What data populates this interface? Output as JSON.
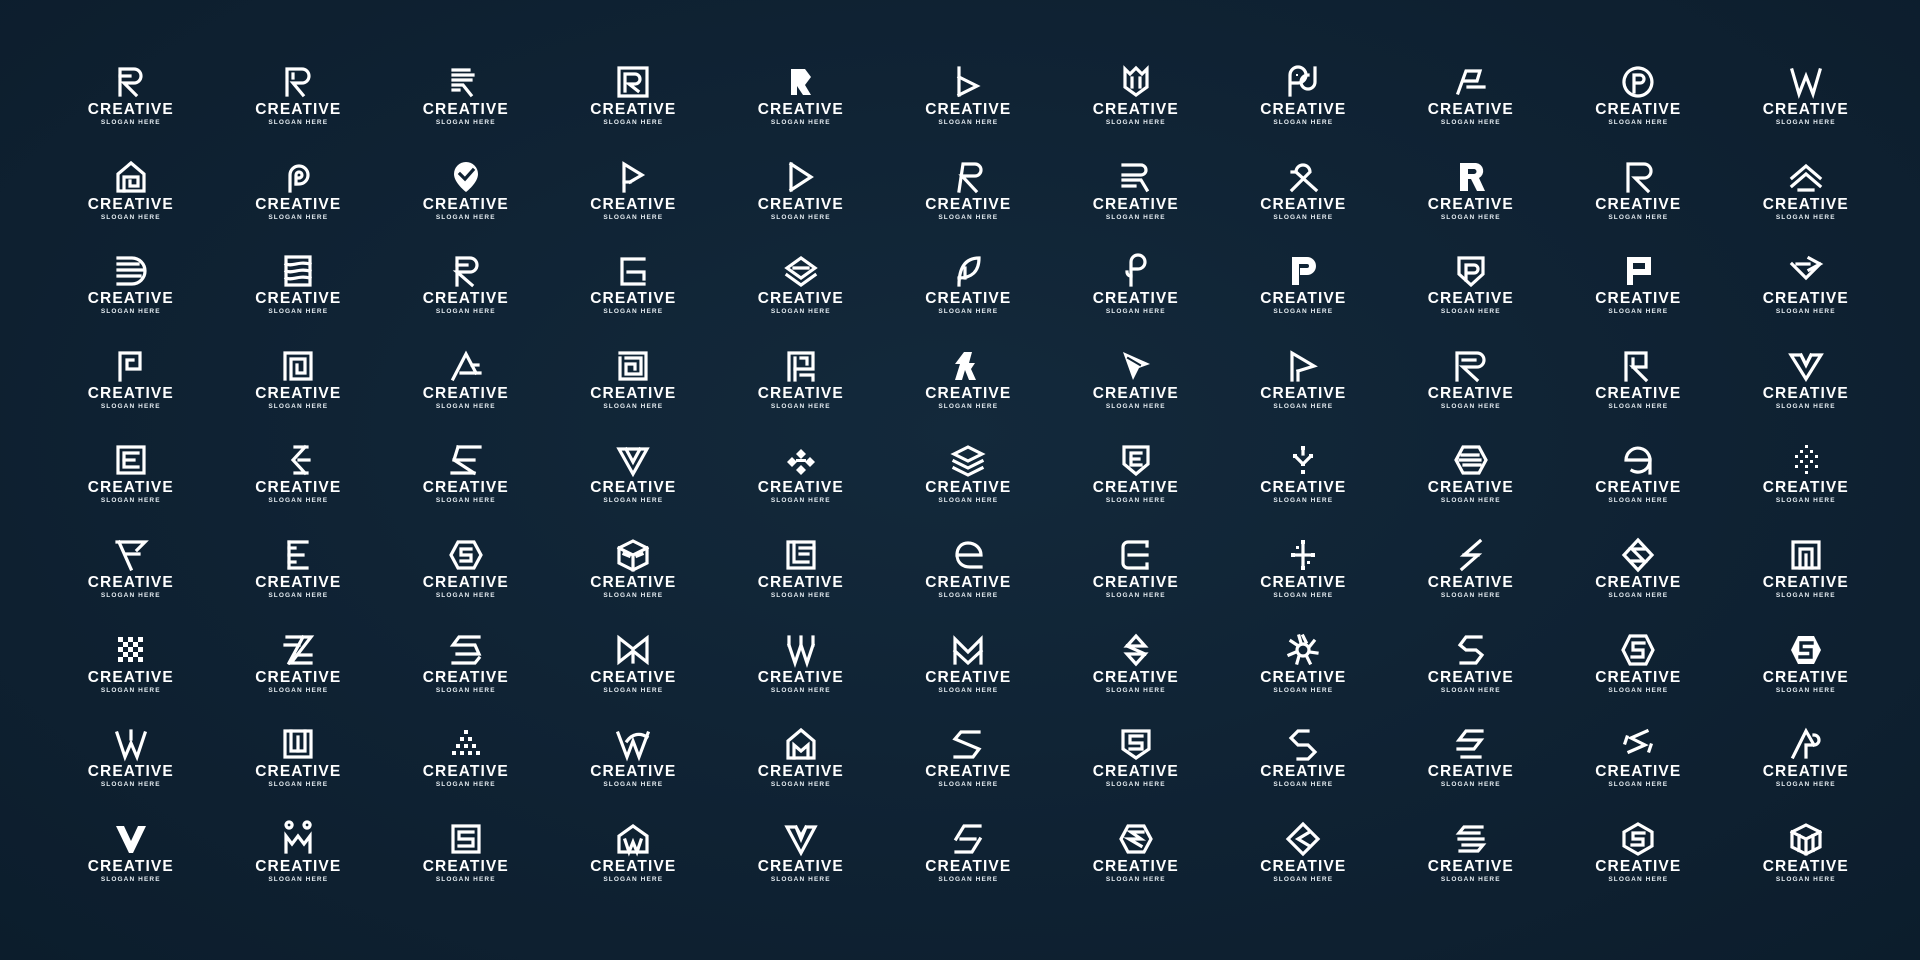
{
  "page": {
    "background_color": "#0f2233",
    "logo_color": "#ffffff"
  },
  "logos": [
    {
      "icon": "letter-r-stencil-icon",
      "brand": "CREATIVE",
      "slogan": "SLOGAN HERE"
    },
    {
      "icon": "letter-r-outline-icon",
      "brand": "CREATIVE",
      "slogan": "SLOGAN HERE"
    },
    {
      "icon": "letter-r-striped-icon",
      "brand": "CREATIVE",
      "slogan": "SLOGAN HERE"
    },
    {
      "icon": "letter-r-square-box-icon",
      "brand": "CREATIVE",
      "slogan": "SLOGAN HERE"
    },
    {
      "icon": "letter-r-geometric-icon",
      "brand": "CREATIVE",
      "slogan": "SLOGAN HERE"
    },
    {
      "icon": "letter-b-play-icon",
      "brand": "CREATIVE",
      "slogan": "SLOGAN HERE"
    },
    {
      "icon": "crown-shield-icon",
      "brand": "CREATIVE",
      "slogan": "SLOGAN HERE"
    },
    {
      "icon": "letter-pa-chat-icon",
      "brand": "CREATIVE",
      "slogan": "SLOGAN HERE"
    },
    {
      "icon": "letter-p-angled-icon",
      "brand": "CREATIVE",
      "slogan": "SLOGAN HERE"
    },
    {
      "icon": "letter-p-circle-icon",
      "brand": "CREATIVE",
      "slogan": "SLOGAN HERE"
    },
    {
      "icon": "letter-w-line-icon",
      "brand": "CREATIVE",
      "slogan": "SLOGAN HERE"
    },
    {
      "icon": "house-maze-icon",
      "brand": "CREATIVE",
      "slogan": "SLOGAN HERE"
    },
    {
      "icon": "letter-p-loop-icon",
      "brand": "CREATIVE",
      "slogan": "SLOGAN HERE"
    },
    {
      "icon": "pin-check-icon",
      "brand": "CREATIVE",
      "slogan": "SLOGAN HERE"
    },
    {
      "icon": "letter-p-triangle-icon",
      "brand": "CREATIVE",
      "slogan": "SLOGAN HERE"
    },
    {
      "icon": "letter-d-play-icon",
      "brand": "CREATIVE",
      "slogan": "SLOGAN HERE"
    },
    {
      "icon": "letter-r-slant-icon",
      "brand": "CREATIVE",
      "slogan": "SLOGAN HERE"
    },
    {
      "icon": "letter-r-lines-icon",
      "brand": "CREATIVE",
      "slogan": "SLOGAN HERE"
    },
    {
      "icon": "letter-r-knot-icon",
      "brand": "CREATIVE",
      "slogan": "SLOGAN HERE"
    },
    {
      "icon": "letter-r-bold-icon",
      "brand": "CREATIVE",
      "slogan": "SLOGAN HERE"
    },
    {
      "icon": "letter-r-modern-icon",
      "brand": "CREATIVE",
      "slogan": "SLOGAN HERE"
    },
    {
      "icon": "layered-chevron-icon",
      "brand": "CREATIVE",
      "slogan": "SLOGAN HERE"
    },
    {
      "icon": "letter-d-striped-icon",
      "brand": "CREATIVE",
      "slogan": "SLOGAN HERE"
    },
    {
      "icon": "letter-b-waves-icon",
      "brand": "CREATIVE",
      "slogan": "SLOGAN HERE"
    },
    {
      "icon": "letter-r-round-icon",
      "brand": "CREATIVE",
      "slogan": "SLOGAN HERE"
    },
    {
      "icon": "letter-e-rounded-icon",
      "brand": "CREATIVE",
      "slogan": "SLOGAN HERE"
    },
    {
      "icon": "layered-diamond-icon",
      "brand": "CREATIVE",
      "slogan": "SLOGAN HERE"
    },
    {
      "icon": "letter-p-leaf-icon",
      "brand": "CREATIVE",
      "slogan": "SLOGAN HERE"
    },
    {
      "icon": "letter-p-script-icon",
      "brand": "CREATIVE",
      "slogan": "SLOGAN HERE"
    },
    {
      "icon": "letter-p-dot-icon",
      "brand": "CREATIVE",
      "slogan": "SLOGAN HERE"
    },
    {
      "icon": "letter-p-shield-icon",
      "brand": "CREATIVE",
      "slogan": "SLOGAN HERE"
    },
    {
      "icon": "letter-p-pixel-icon",
      "brand": "CREATIVE",
      "slogan": "SLOGAN HERE"
    },
    {
      "icon": "layered-arrow-icon",
      "brand": "CREATIVE",
      "slogan": "SLOGAN HERE"
    },
    {
      "icon": "letter-p-outline-icon",
      "brand": "CREATIVE",
      "slogan": "SLOGAN HERE"
    },
    {
      "icon": "square-maze-icon",
      "brand": "CREATIVE",
      "slogan": "SLOGAN HERE"
    },
    {
      "icon": "letter-a-triangle-icon",
      "brand": "CREATIVE",
      "slogan": "SLOGAN HERE"
    },
    {
      "icon": "square-spiral-icon",
      "brand": "CREATIVE",
      "slogan": "SLOGAN HERE"
    },
    {
      "icon": "letter-p-block-icon",
      "brand": "CREATIVE",
      "slogan": "SLOGAN HERE"
    },
    {
      "icon": "letter-r-cut-icon",
      "brand": "CREATIVE",
      "slogan": "SLOGAN HERE"
    },
    {
      "icon": "cursor-arrow-icon",
      "brand": "CREATIVE",
      "slogan": "SLOGAN HERE"
    },
    {
      "icon": "letter-p-arrow-icon",
      "brand": "CREATIVE",
      "slogan": "SLOGAN HERE"
    },
    {
      "icon": "letter-r-wide-icon",
      "brand": "CREATIVE",
      "slogan": "SLOGAN HERE"
    },
    {
      "icon": "letter-r-frame-icon",
      "brand": "CREATIVE",
      "slogan": "SLOGAN HERE"
    },
    {
      "icon": "letter-w-diamond-icon",
      "brand": "CREATIVE",
      "slogan": "SLOGAN HERE"
    },
    {
      "icon": "letter-e-square-icon",
      "brand": "CREATIVE",
      "slogan": "SLOGAN HERE"
    },
    {
      "icon": "letter-e-chevron-icon",
      "brand": "CREATIVE",
      "slogan": "SLOGAN HERE"
    },
    {
      "icon": "letter-e-slant-icon",
      "brand": "CREATIVE",
      "slogan": "SLOGAN HERE"
    },
    {
      "icon": "letter-v-triangle-icon",
      "brand": "CREATIVE",
      "slogan": "SLOGAN HERE"
    },
    {
      "icon": "diamond-cluster-icon",
      "brand": "CREATIVE",
      "slogan": "SLOGAN HERE"
    },
    {
      "icon": "stacked-layers-icon",
      "brand": "CREATIVE",
      "slogan": "SLOGAN HERE"
    },
    {
      "icon": "letter-e-shield-icon",
      "brand": "CREATIVE",
      "slogan": "SLOGAN HERE"
    },
    {
      "icon": "connected-nodes-icon",
      "brand": "CREATIVE",
      "slogan": "SLOGAN HERE"
    },
    {
      "icon": "hexagon-stripes-icon",
      "brand": "CREATIVE",
      "slogan": "SLOGAN HERE"
    },
    {
      "icon": "letter-e-circle-icon",
      "brand": "CREATIVE",
      "slogan": "SLOGAN HERE"
    },
    {
      "icon": "pixel-diamond-icon",
      "brand": "CREATIVE",
      "slogan": "SLOGAN HERE"
    },
    {
      "icon": "letter-f-arrow-icon",
      "brand": "CREATIVE",
      "slogan": "SLOGAN HERE"
    },
    {
      "icon": "letter-e-dashed-icon",
      "brand": "CREATIVE",
      "slogan": "SLOGAN HERE"
    },
    {
      "icon": "letter-s-hexagon-icon",
      "brand": "CREATIVE",
      "slogan": "SLOGAN HERE"
    },
    {
      "icon": "cube-stripes-icon",
      "brand": "CREATIVE",
      "slogan": "SLOGAN HERE"
    },
    {
      "icon": "letter-e-maze-icon",
      "brand": "CREATIVE",
      "slogan": "SLOGAN HERE"
    },
    {
      "icon": "letter-e-leaf-icon",
      "brand": "CREATIVE",
      "slogan": "SLOGAN HERE"
    },
    {
      "icon": "letter-e-tech-icon",
      "brand": "CREATIVE",
      "slogan": "SLOGAN HERE"
    },
    {
      "icon": "dot-network-icon",
      "brand": "CREATIVE",
      "slogan": "SLOGAN HERE"
    },
    {
      "icon": "letter-s-zigzag-icon",
      "brand": "CREATIVE",
      "slogan": "SLOGAN HERE"
    },
    {
      "icon": "letter-s-diamond-icon",
      "brand": "CREATIVE",
      "slogan": "SLOGAN HERE"
    },
    {
      "icon": "square-frame-icon",
      "brand": "CREATIVE",
      "slogan": "SLOGAN HERE"
    },
    {
      "icon": "checker-pattern-icon",
      "brand": "CREATIVE",
      "slogan": "SLOGAN HERE"
    },
    {
      "icon": "letter-z-stripes-icon",
      "brand": "CREATIVE",
      "slogan": "SLOGAN HERE"
    },
    {
      "icon": "letter-s-layered-icon",
      "brand": "CREATIVE",
      "slogan": "SLOGAN HERE"
    },
    {
      "icon": "letter-m-bowtie-icon",
      "brand": "CREATIVE",
      "slogan": "SLOGAN HERE"
    },
    {
      "icon": "letter-w-pillars-icon",
      "brand": "CREATIVE",
      "slogan": "SLOGAN HERE"
    },
    {
      "icon": "letter-m-cross-icon",
      "brand": "CREATIVE",
      "slogan": "SLOGAN HERE"
    },
    {
      "icon": "letter-s-gem-icon",
      "brand": "CREATIVE",
      "slogan": "SLOGAN HERE"
    },
    {
      "icon": "spiral-sun-icon",
      "brand": "CREATIVE",
      "slogan": "SLOGAN HERE"
    },
    {
      "icon": "letter-s-angular-icon",
      "brand": "CREATIVE",
      "slogan": "SLOGAN HERE"
    },
    {
      "icon": "letter-s-hex-outline-icon",
      "brand": "CREATIVE",
      "slogan": "SLOGAN HERE"
    },
    {
      "icon": "letter-s-hex-solid-icon",
      "brand": "CREATIVE",
      "slogan": "SLOGAN HERE"
    },
    {
      "icon": "letter-w-crown-icon",
      "brand": "CREATIVE",
      "slogan": "SLOGAN HERE"
    },
    {
      "icon": "letter-w-square-icon",
      "brand": "CREATIVE",
      "slogan": "SLOGAN HERE"
    },
    {
      "icon": "dot-triangle-icon",
      "brand": "CREATIVE",
      "slogan": "SLOGAN HERE"
    },
    {
      "icon": "letter-w-swoosh-icon",
      "brand": "CREATIVE",
      "slogan": "SLOGAN HERE"
    },
    {
      "icon": "letter-w-house-icon",
      "brand": "CREATIVE",
      "slogan": "SLOGAN HERE"
    },
    {
      "icon": "letter-s-ribbon-icon",
      "brand": "CREATIVE",
      "slogan": "SLOGAN HERE"
    },
    {
      "icon": "letter-s-badge-icon",
      "brand": "CREATIVE",
      "slogan": "SLOGAN HERE"
    },
    {
      "icon": "letter-s-chain-icon",
      "brand": "CREATIVE",
      "slogan": "SLOGAN HERE"
    },
    {
      "icon": "letter-s-bolt-icon",
      "brand": "CREATIVE",
      "slogan": "SLOGAN HERE"
    },
    {
      "icon": "letter-s-wave-icon",
      "brand": "CREATIVE",
      "slogan": "SLOGAN HERE"
    },
    {
      "icon": "letter-a-p-icon",
      "brand": "CREATIVE",
      "slogan": "SLOGAN HERE"
    },
    {
      "icon": "letter-w-bold-icon",
      "brand": "CREATIVE",
      "slogan": "SLOGAN HERE"
    },
    {
      "icon": "letter-w-pins-icon",
      "brand": "CREATIVE",
      "slogan": "SLOGAN HERE"
    },
    {
      "icon": "letter-s-box-icon",
      "brand": "CREATIVE",
      "slogan": "SLOGAN HERE"
    },
    {
      "icon": "letter-w-house-outline-icon",
      "brand": "CREATIVE",
      "slogan": "SLOGAN HERE"
    },
    {
      "icon": "letter-w-heart-icon",
      "brand": "CREATIVE",
      "slogan": "SLOGAN HERE"
    },
    {
      "icon": "letter-s-cut-icon",
      "brand": "CREATIVE",
      "slogan": "SLOGAN HERE"
    },
    {
      "icon": "letter-s-hex-wide-icon",
      "brand": "CREATIVE",
      "slogan": "SLOGAN HERE"
    },
    {
      "icon": "letter-s-diamond-outline-icon",
      "brand": "CREATIVE",
      "slogan": "SLOGAN HERE"
    },
    {
      "icon": "letter-s-stacked-icon",
      "brand": "CREATIVE",
      "slogan": "SLOGAN HERE"
    },
    {
      "icon": "letter-s-hex-ring-icon",
      "brand": "CREATIVE",
      "slogan": "SLOGAN HERE"
    },
    {
      "icon": "cube-grid-icon",
      "brand": "CREATIVE",
      "slogan": "SLOGAN HERE"
    }
  ]
}
